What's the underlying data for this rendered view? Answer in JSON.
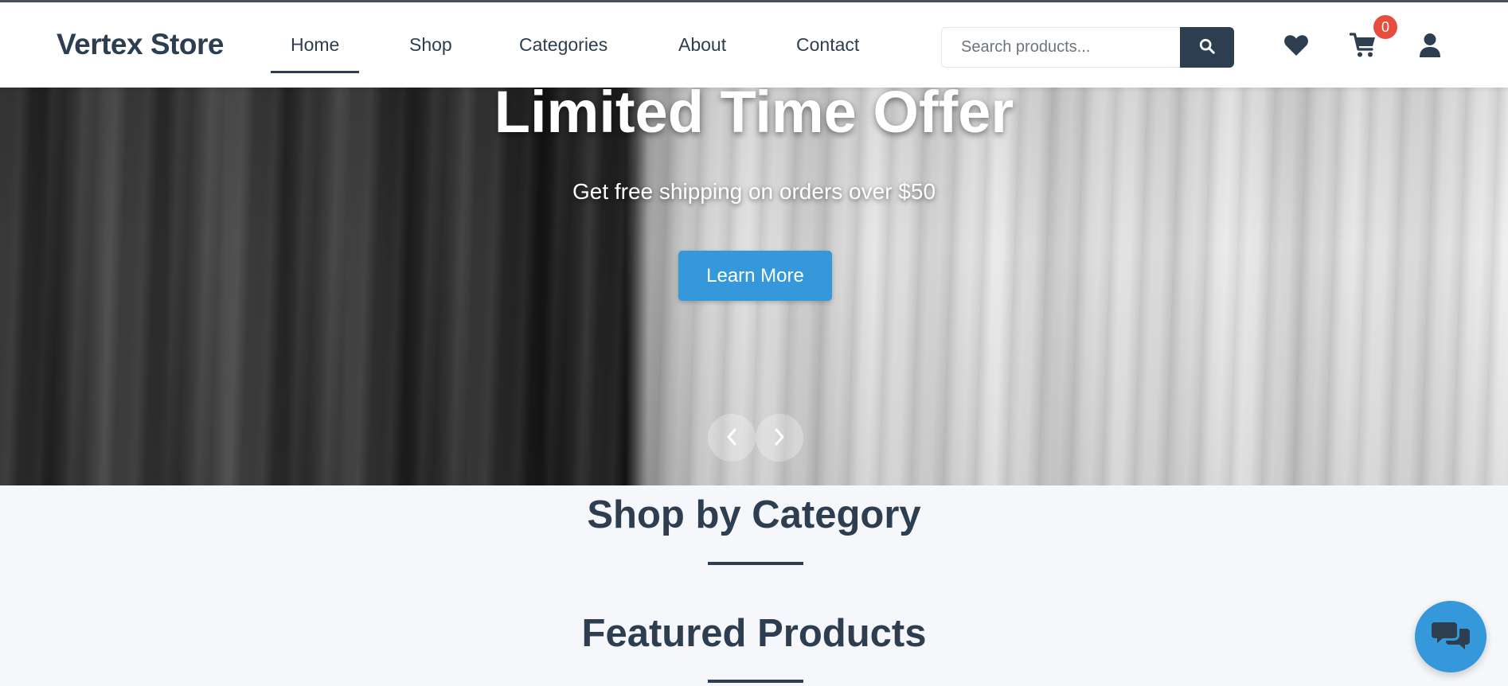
{
  "header": {
    "logo": "Vertex Store",
    "nav": [
      {
        "label": "Home",
        "active": true
      },
      {
        "label": "Shop"
      },
      {
        "label": "Categories"
      },
      {
        "label": "About"
      },
      {
        "label": "Contact"
      }
    ],
    "search": {
      "placeholder": "Search products...",
      "value": "",
      "button_icon": "search-icon"
    },
    "icons": {
      "wishlist": "heart-icon",
      "cart": "cart-icon",
      "account": "user-icon"
    },
    "cart_count": "0"
  },
  "hero": {
    "title": "Limited Time Offer",
    "subtitle": "Get free shipping on orders over $50",
    "cta": "Learn More",
    "prev_icon": "chevron-left-icon",
    "next_icon": "chevron-right-icon"
  },
  "sections": {
    "categories_title": "Shop by Category",
    "featured_title": "Featured Products"
  },
  "chat": {
    "icon": "chat-bubbles-icon"
  },
  "colors": {
    "primary_dark": "#2c3e50",
    "accent_blue": "#3498db",
    "badge_red": "#e74c3c",
    "page_bg": "#f5f7fa"
  }
}
